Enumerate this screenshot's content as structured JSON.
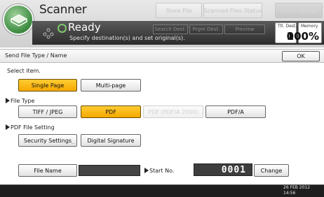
{
  "header": {
    "app_title": "Scanner",
    "store_file": "Store File",
    "scanned_files_status": "Scanned Files Status",
    "check_modes": "Check Modes",
    "status": "Ready",
    "status_message": "Specify destination(s) and set original(s).",
    "search_dest": "Search Dest.",
    "prgm_dest": "Prgm Dest.",
    "preview": "Preview",
    "tx_dest_label": "Ttl. Dest.",
    "tx_dest_value": "0",
    "memory_label": "Memory",
    "memory_value": "100%",
    "accent_color": "#f5a800",
    "icon": "scanner-app-icon"
  },
  "dialog": {
    "title": "Send File Type / Name",
    "ok": "OK",
    "select_item": "Select item.",
    "page_options": [
      "Single Page",
      "Multi-page"
    ],
    "selected_page": "Single Page",
    "file_type_label": "File Type",
    "file_types": [
      "TIFF / JPEG",
      "PDF",
      "PDF (PDF/A 2000)",
      "PDF/A"
    ],
    "selected_file_type": "PDF",
    "pdf_setting_label": "PDF File Setting",
    "security_settings": "Security Settings",
    "digital_signature": "Digital Signature",
    "file_name": "File Name",
    "start_no_label": "Start No.",
    "start_no_value": "0001",
    "change": "Change"
  },
  "footer": {
    "date": "26 FEB  2012",
    "time": "14:56"
  }
}
